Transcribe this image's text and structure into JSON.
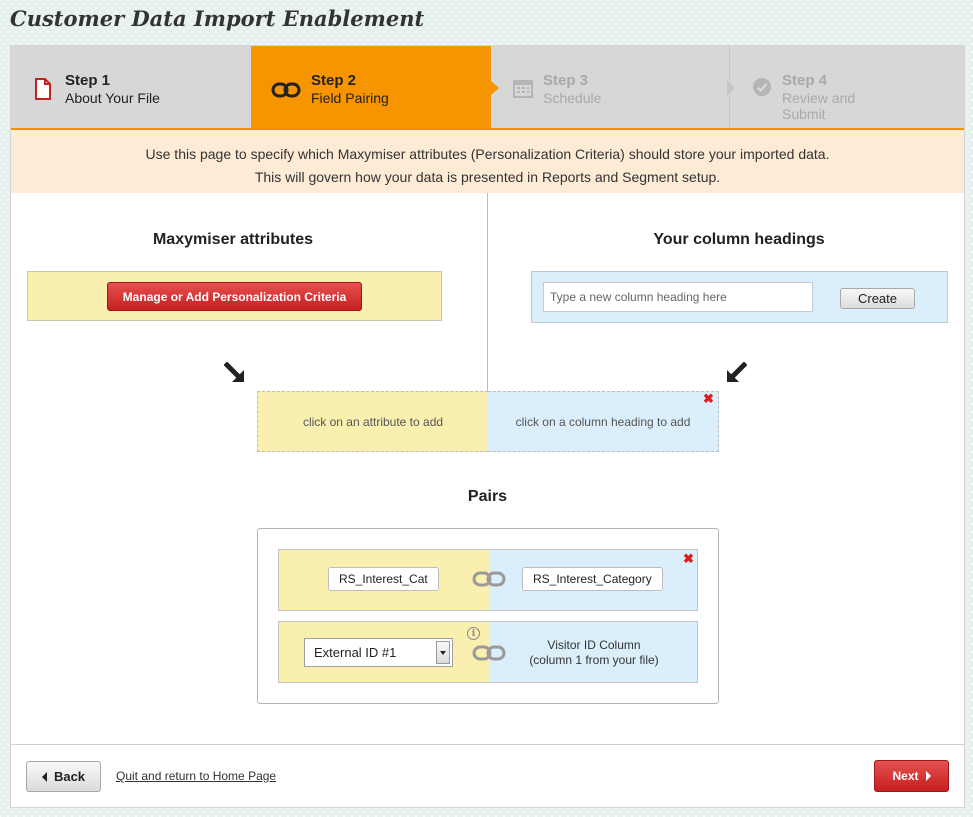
{
  "page": {
    "title": "Customer Data Import Enablement"
  },
  "steps": [
    {
      "num": "Step 1",
      "name": "About Your File",
      "state": "done",
      "icon": "document-icon"
    },
    {
      "num": "Step 2",
      "name": "Field Pairing",
      "state": "active",
      "icon": "link-icon"
    },
    {
      "num": "Step 3",
      "name": "Schedule",
      "state": "disabled",
      "icon": "calendar-icon"
    },
    {
      "num": "Step 4",
      "name": "Review and Submit",
      "state": "disabled",
      "icon": "check-circle-icon"
    }
  ],
  "info": {
    "line1": "Use this page to specify which Maxymiser attributes (Personalization Criteria) should store your imported data.",
    "line2": "This will govern how your data is presented in Reports and Segment setup."
  },
  "attributes": {
    "title": "Maxymiser attributes",
    "manage_button": "Manage or Add Personalization Criteria"
  },
  "columns": {
    "title": "Your column headings",
    "input_placeholder": "Type a new column heading here",
    "input_value": "",
    "create_button": "Create"
  },
  "drop": {
    "left_hint": "click on an attribute to add",
    "right_hint": "click on a column heading to add"
  },
  "pairs": {
    "title": "Pairs",
    "rows": [
      {
        "attribute": "RS_Interest_Cat",
        "column": "RS_Interest_Category"
      },
      {
        "attribute_select": "External ID #1",
        "column_line1": "Visitor ID Column",
        "column_line2": "(column 1 from your file)"
      }
    ]
  },
  "footer": {
    "back_label": "Back",
    "quit_label": "Quit and return to Home Page",
    "next_label": "Next"
  },
  "colors": {
    "accent_orange": "#f79500",
    "attribute_yellow": "#f9f0b0",
    "column_blue": "#dbeefb",
    "button_red": "#d22a2a"
  }
}
